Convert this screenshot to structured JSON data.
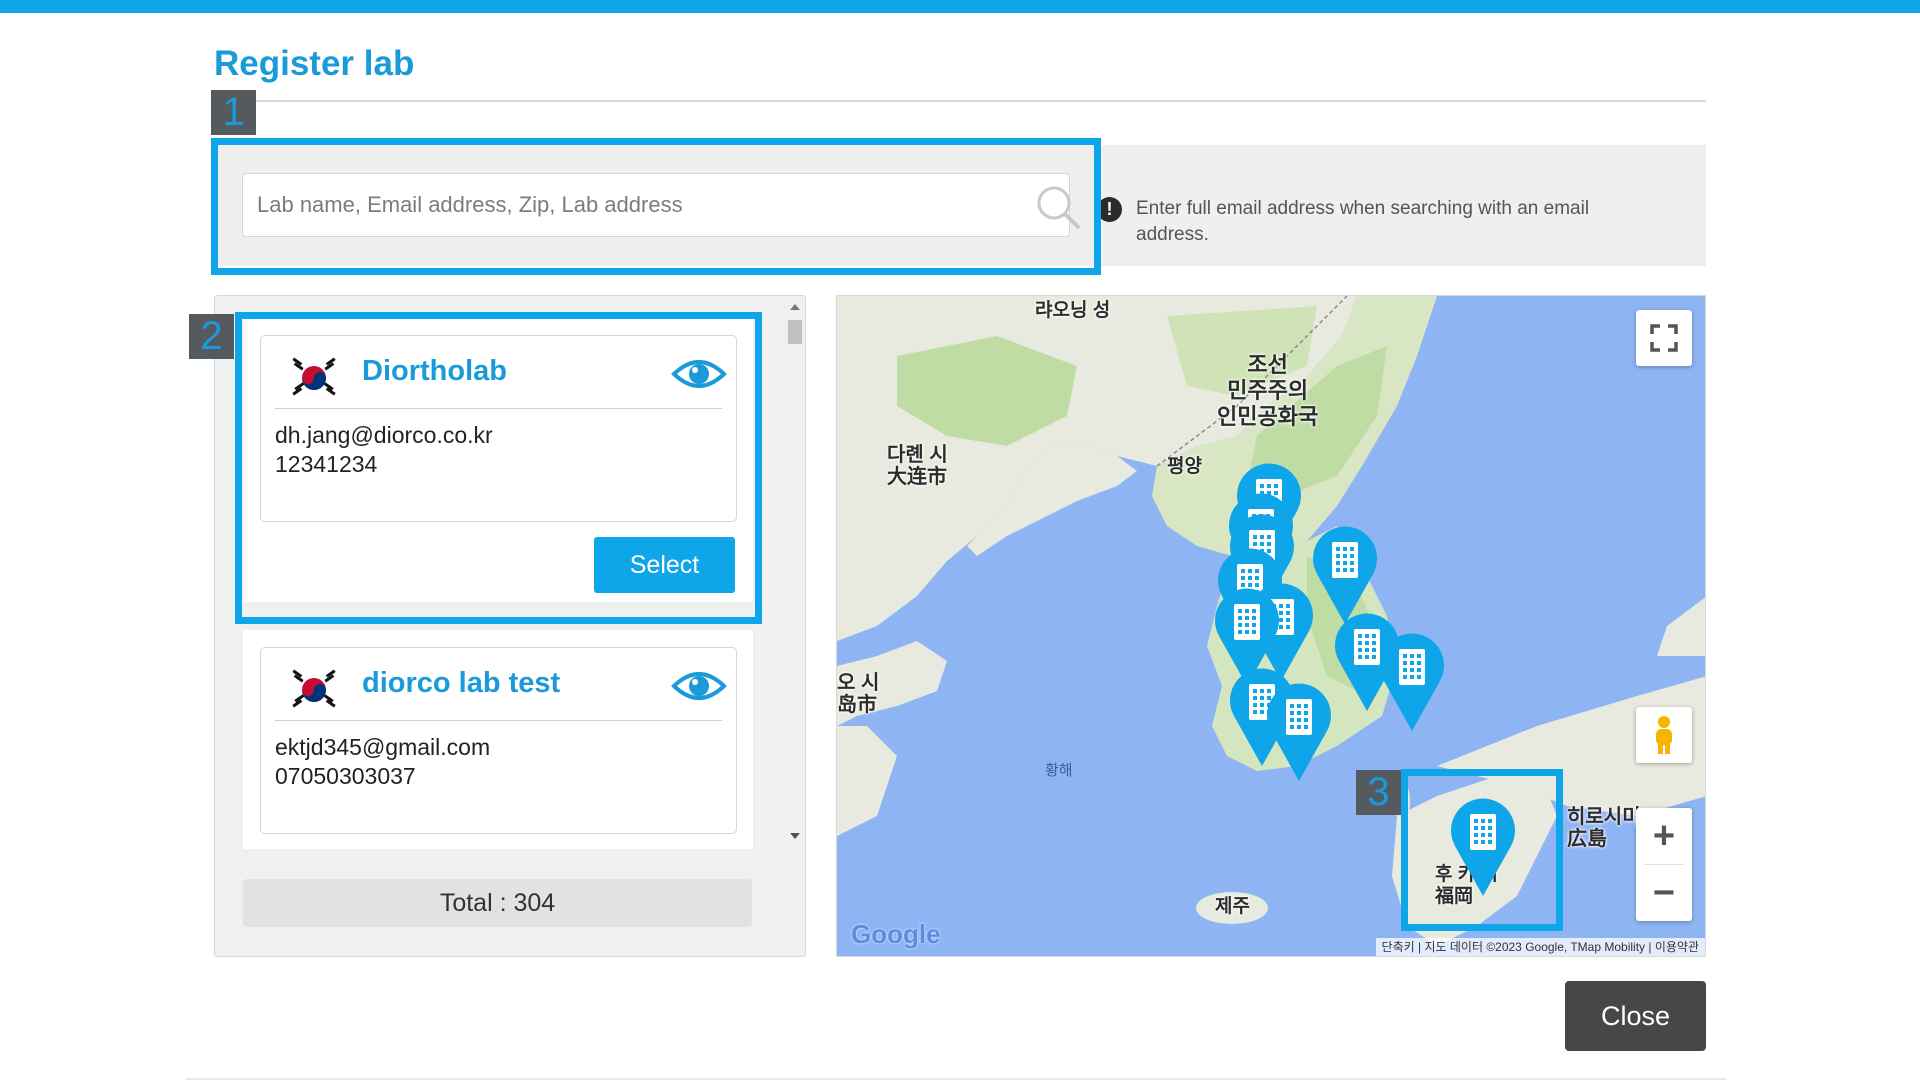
{
  "dialog": {
    "title": "Register lab"
  },
  "steps": {
    "one": "1",
    "two": "2",
    "three": "3"
  },
  "search": {
    "placeholder": "Lab name, Email address, Zip, Lab address",
    "notice": "Enter full email address when searching with an email address."
  },
  "labs": [
    {
      "name": "Diortholab",
      "email": "dh.jang@diorco.co.kr",
      "phone": "12341234",
      "select_label": "Select"
    },
    {
      "name": "diorco lab test",
      "email": "ektjd345@gmail.com",
      "phone": "07050303037"
    }
  ],
  "list": {
    "total_label": "Total : 304"
  },
  "map": {
    "labels": {
      "laoning": "랴오닝 성",
      "north_korea": "조선\n민주주의\n인민공화국",
      "pyongyang": "평양",
      "dalian": "다롄 시\n大连市",
      "yellow_sea": "황해",
      "qingdao": "오 시\n岛市",
      "jeju": "제주",
      "hiroshima": "히로시미\n広島",
      "fukuoka": "후 카 시\n福岡"
    },
    "attribution": {
      "shortcuts": "단축키",
      "data": "지도 데이터 ©2023 Google, TMap Mobility",
      "terms": "이용약관"
    },
    "logo": "Google",
    "zoom_in": "+",
    "zoom_out": "−",
    "colors": {
      "water": "#8fb4f4",
      "land": "#e8eadf",
      "park": "#bfdca5",
      "marker": "#0ea5e9"
    }
  },
  "footer": {
    "close_label": "Close"
  },
  "colors": {
    "accent": "#0ea5e9",
    "title": "#1a9ad9",
    "close": "#474747"
  }
}
